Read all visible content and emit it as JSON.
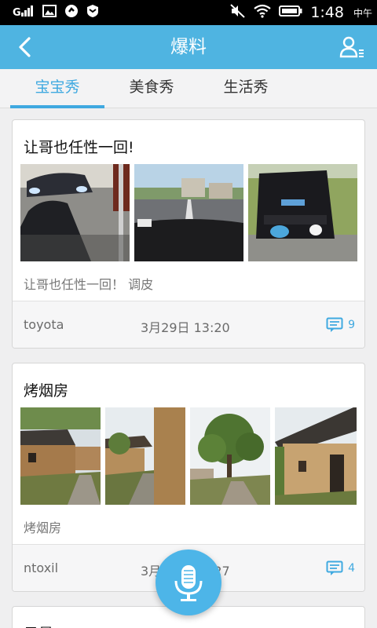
{
  "status_bar": {
    "time": "1:48",
    "ampm": "中午",
    "signal_label": "G",
    "colors": {
      "background": "#000000",
      "text": "#ffffff"
    }
  },
  "header": {
    "title": "爆料",
    "back_icon": "chevron-left-icon",
    "user_icon": "user-list-icon",
    "colors": {
      "background": "#4fb4e1",
      "text": "#ffffff"
    }
  },
  "tabs": [
    {
      "label": "宝宝秀",
      "active": true
    },
    {
      "label": "美食秀",
      "active": false
    },
    {
      "label": "生活秀",
      "active": false
    }
  ],
  "accent_color": "#3fa9e0",
  "posts": [
    {
      "title": "让哥也任性一回!",
      "description": "让哥也任性一回！ 调皮",
      "author": "toyota",
      "time": "3月29日 13:20",
      "comments": "9",
      "photos": [
        "car-headlights-photo",
        "road-windshield-photo",
        "car-rear-photo"
      ]
    },
    {
      "title": "烤烟房",
      "description": "烤烟房",
      "author": "ntoxil",
      "time": "3月23日 17:27",
      "comments": "4",
      "photos": [
        "mud-house-photo",
        "village-path-photo",
        "tree-path-photo",
        "old-house-photo"
      ]
    },
    {
      "title": "风景"
    }
  ],
  "fab": {
    "icon": "microphone-icon"
  }
}
